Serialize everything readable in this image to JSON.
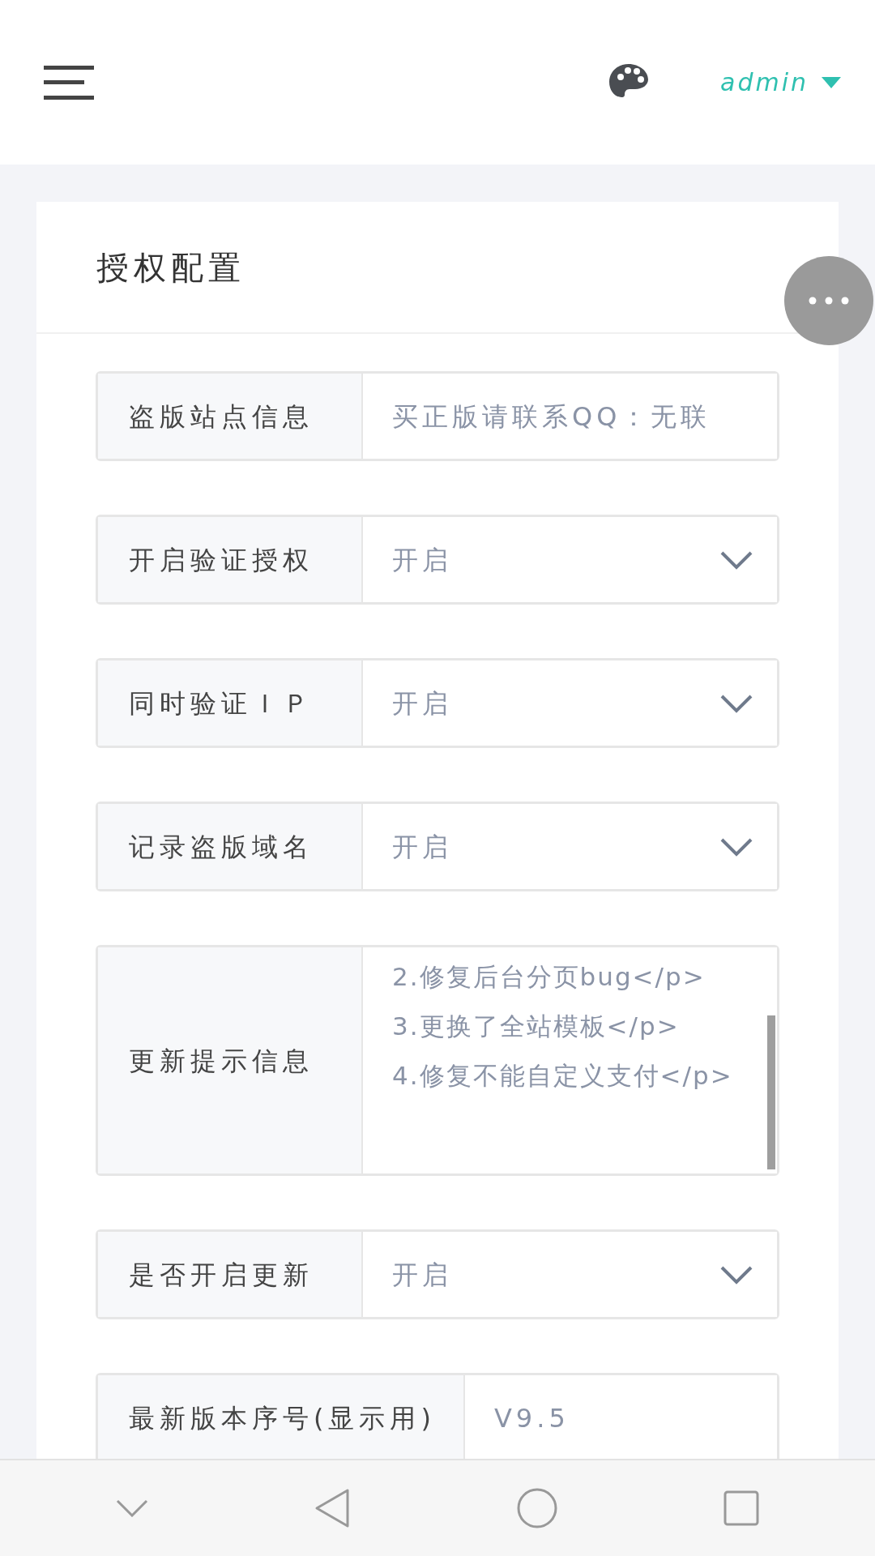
{
  "header": {
    "user": "admin"
  },
  "card": {
    "title": "授权配置"
  },
  "fields": [
    {
      "kind": "text",
      "label": "盗版站点信息",
      "value": "买正版请联系QQ：无联"
    },
    {
      "kind": "select",
      "label": "开启验证授权",
      "value": "开启"
    },
    {
      "kind": "select",
      "label": "同时验证ＩＰ",
      "value": "开启"
    },
    {
      "kind": "select",
      "label": "记录盗版域名",
      "value": "开启"
    },
    {
      "kind": "textarea",
      "label": "更新提示信息",
      "value": "2.修复后台分页bug</p>\n3.更换了全站模板</p>\n4.修复不能自定义支付</p>"
    },
    {
      "kind": "select",
      "label": "是否开启更新",
      "value": "开启"
    },
    {
      "kind": "text",
      "label": "最新版本序号(显示用)",
      "value": "V9.5"
    }
  ]
}
